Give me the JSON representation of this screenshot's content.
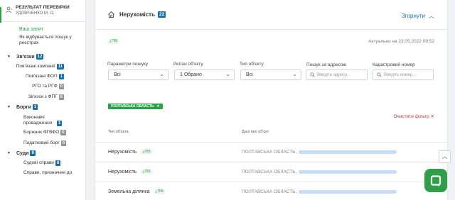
{
  "sidebar": {
    "title": "РЕЗУЛЬТАТ ПЕРЕВІРКИ",
    "subtitle": "УДОВІЧЕНКО М. О.",
    "request_link": "Ваш запит",
    "how_search": "Як відбувається пошук у реєстрах",
    "groups": [
      {
        "label": "Зв'язки",
        "count": "12",
        "items": [
          {
            "label": "Пов'язані компанії",
            "count": "11",
            "badge_color": "blue"
          },
          {
            "label": "Пов'язані ФОП",
            "count": "1",
            "badge_color": "blue"
          },
          {
            "label": "РГО та РГФ",
            "count": "0",
            "badge_color": "gray"
          },
          {
            "label": "Зв'язок з ФПГ",
            "count": "0",
            "badge_color": "gray"
          }
        ]
      },
      {
        "label": "Борги",
        "count": "1",
        "items": [
          {
            "label": "Виконавчі провадження",
            "count": "1",
            "badge_color": "blue"
          },
          {
            "label": "Боржник ФГВФО",
            "count": "0",
            "badge_color": "gray"
          },
          {
            "label": "Податковий борг",
            "count": "0",
            "badge_color": "gray"
          }
        ]
      },
      {
        "label": "Суди",
        "count": "9",
        "items": [
          {
            "label": "Судові справи",
            "count": "6",
            "badge_color": "blue"
          },
          {
            "label": "Справи, призначені до",
            "count": "",
            "badge_color": "blue"
          }
        ]
      }
    ]
  },
  "main": {
    "title": "Нерухомість",
    "count": "22",
    "collapse_label": "Згорнути",
    "source_tag": "ПІБ",
    "updated": "Актуально на 23.05.2022 09:52",
    "filters": {
      "params_label": "Параметри пошуку",
      "params_value": "Всі",
      "region_label": "Регіон об'єкту",
      "region_value": "1 Обрано",
      "type_label": "Тип об'єкту",
      "type_value": "Всі",
      "address_label": "Пошук за адресою",
      "address_placeholder": "Введіть адресу...",
      "cadastre_label": "Кадастровий номер",
      "cadastre_placeholder": "Введіть номер..."
    },
    "active_filter": "ПОЛТАВСЬКА ОБЛАСТЬ",
    "clear_filter": "Очистити фільтр",
    "columns": {
      "type": "Тип об'єкта",
      "data": "Дані про об'єкт"
    },
    "rows": [
      {
        "type": "Нерухомість",
        "tag": "ПІБ",
        "address": "ПОЛТАВСЬКА ОБЛАСТЬ,"
      },
      {
        "type": "Нерухомість",
        "tag": "ПІБ",
        "address": "ПОЛТАВСЬКА ОБЛАСТЬ,"
      },
      {
        "type": "Земельна ділянка",
        "tag": "ПІБ",
        "address": "ПОЛТАВСЬКА ОБЛАСТЬ,"
      }
    ]
  },
  "colors": {
    "accent_green": "#2e9e49",
    "accent_blue": "#1a6fa8",
    "danger": "#c9303e"
  },
  "icons": {
    "home": "home-icon",
    "person": "person-icon",
    "search": "search-icon",
    "chat": "chat-icon",
    "download": "download-icon"
  }
}
